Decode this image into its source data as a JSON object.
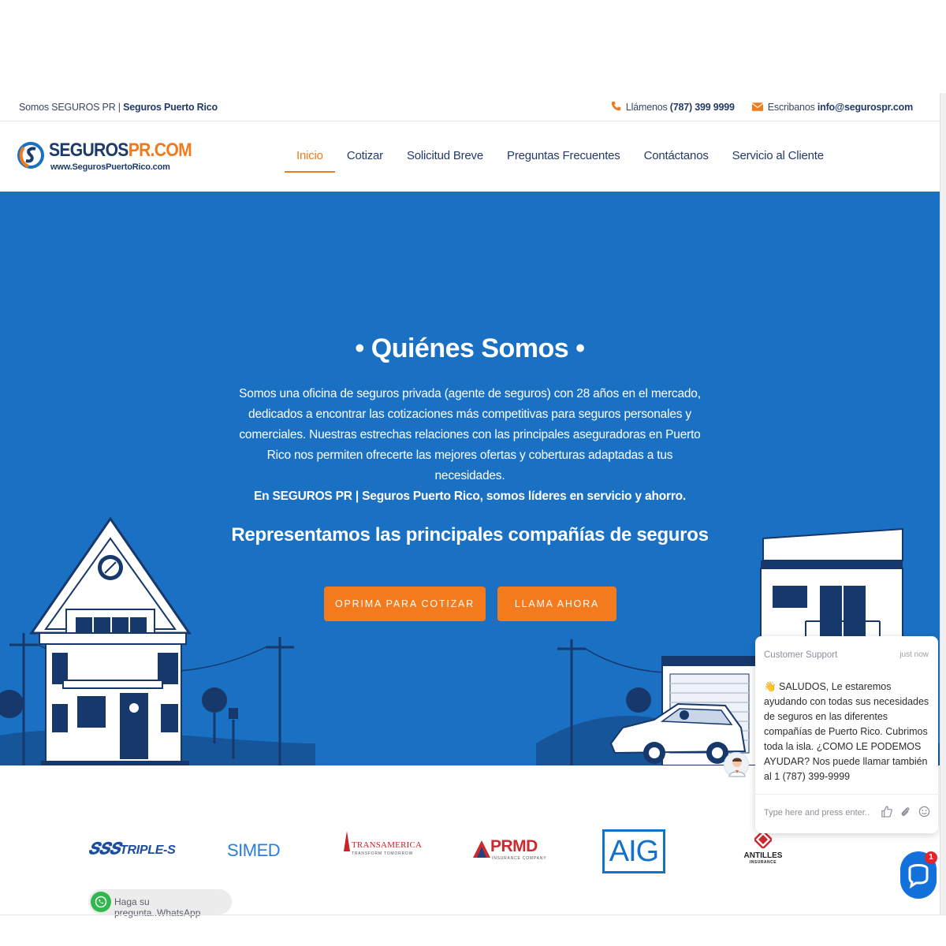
{
  "topbar": {
    "brand_prefix": "Somos SEGUROS PR | ",
    "brand_bold": "Seguros Puerto Rico",
    "phone_prefix": "Llámenos ",
    "phone": "(787) 399 9999",
    "email_prefix": "Escribanos ",
    "email": "info@segurospr.com"
  },
  "logo": {
    "name_part1": "SEGUROS",
    "name_part2": "PR.COM",
    "url": "www.SegurosPuertoRico.com"
  },
  "nav": {
    "items": [
      "Inicio",
      "Cotizar",
      "Solicitud Breve",
      "Preguntas Frecuentes",
      "Contáctanos",
      "Servicio al Cliente"
    ]
  },
  "hero": {
    "title": "• Quiénes Somos •",
    "paragraph": "Somos una oficina de seguros privada (agente de seguros) con 28 años en el mercado, dedicados a encontrar las cotizaciones más competitivas para seguros personales y comerciales. Nuestras estrechas relaciones con las principales aseguradoras en Puerto Rico nos permiten ofrecerte las mejores ofertas y coberturas adaptadas a tus necesidades.",
    "paragraph_bold": "En SEGUROS PR | Seguros Puerto Rico, somos líderes en servicio y ahorro.",
    "sub_prefix": "Representamos las ",
    "sub_bold": "principales compañías de seguros",
    "btn_quote": "OPRIMA PARA COTIZAR",
    "btn_call": "LLAMA AHORA"
  },
  "partners": {
    "triple_s": "TRIPLE-S",
    "simed": "SIMED",
    "transamerica": "TRANSAMERICA",
    "transamerica_tag": "TRANSFORM TOMORROW",
    "prmd": "PRMD",
    "prmd_tag": "INSURANCE COMPANY",
    "aig": "AIG",
    "antilles": "ANTILLES",
    "antilles_tag": "INSURANCE"
  },
  "chat": {
    "header": "Customer Support",
    "time": "just now",
    "message": "👋 SALUDOS, Le estaremos ayudando con todas sus necesidades de seguros en las diferentes compañías de Puerto Rico. Cubrimos toda la isla. ¿COMO LE PODEMOS AYUDAR? Nos puede llamar también al 1 (787) 399-9999",
    "placeholder": "Type here and press enter..",
    "badge": "1"
  },
  "whatsapp": {
    "label": "Haga su pregunta..WhatsApp"
  },
  "colors": {
    "accent": "#f37b1d",
    "hero_bg": "#1a71c4",
    "navy": "#1c3b6b"
  }
}
